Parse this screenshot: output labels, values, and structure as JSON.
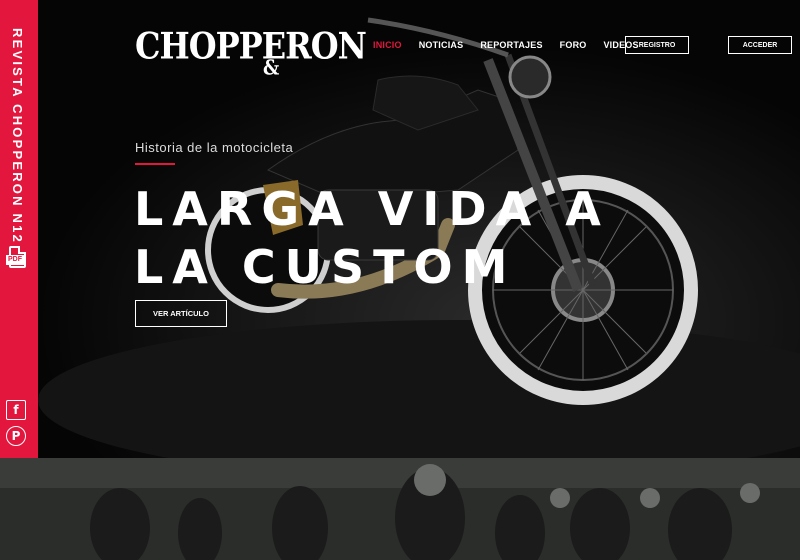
{
  "rail": {
    "title": "REVISTA CHOPPERON N12",
    "pdf_label": "PDF"
  },
  "brand": {
    "logo_text": "CHOPPERON",
    "logo_mark": "&"
  },
  "nav": {
    "items": [
      {
        "label": "INICIO",
        "active": true
      },
      {
        "label": "NOTICIAS"
      },
      {
        "label": "REPORTAJES"
      },
      {
        "label": "FORO"
      },
      {
        "label": "VIDEOS"
      }
    ],
    "register_label": "REGISTRO",
    "login_label": "ACCEDER"
  },
  "hero": {
    "kicker": "Historia de la motocicleta",
    "headline_line1": "LARGA VIDA A",
    "headline_line2": "LA CUSTOM",
    "cta_label": "VER ARTÍCULO"
  },
  "social": {
    "facebook_icon": "facebook-icon",
    "pinterest_icon": "pinterest-icon"
  },
  "colors": {
    "accent": "#e3173e",
    "background": "#000000"
  }
}
